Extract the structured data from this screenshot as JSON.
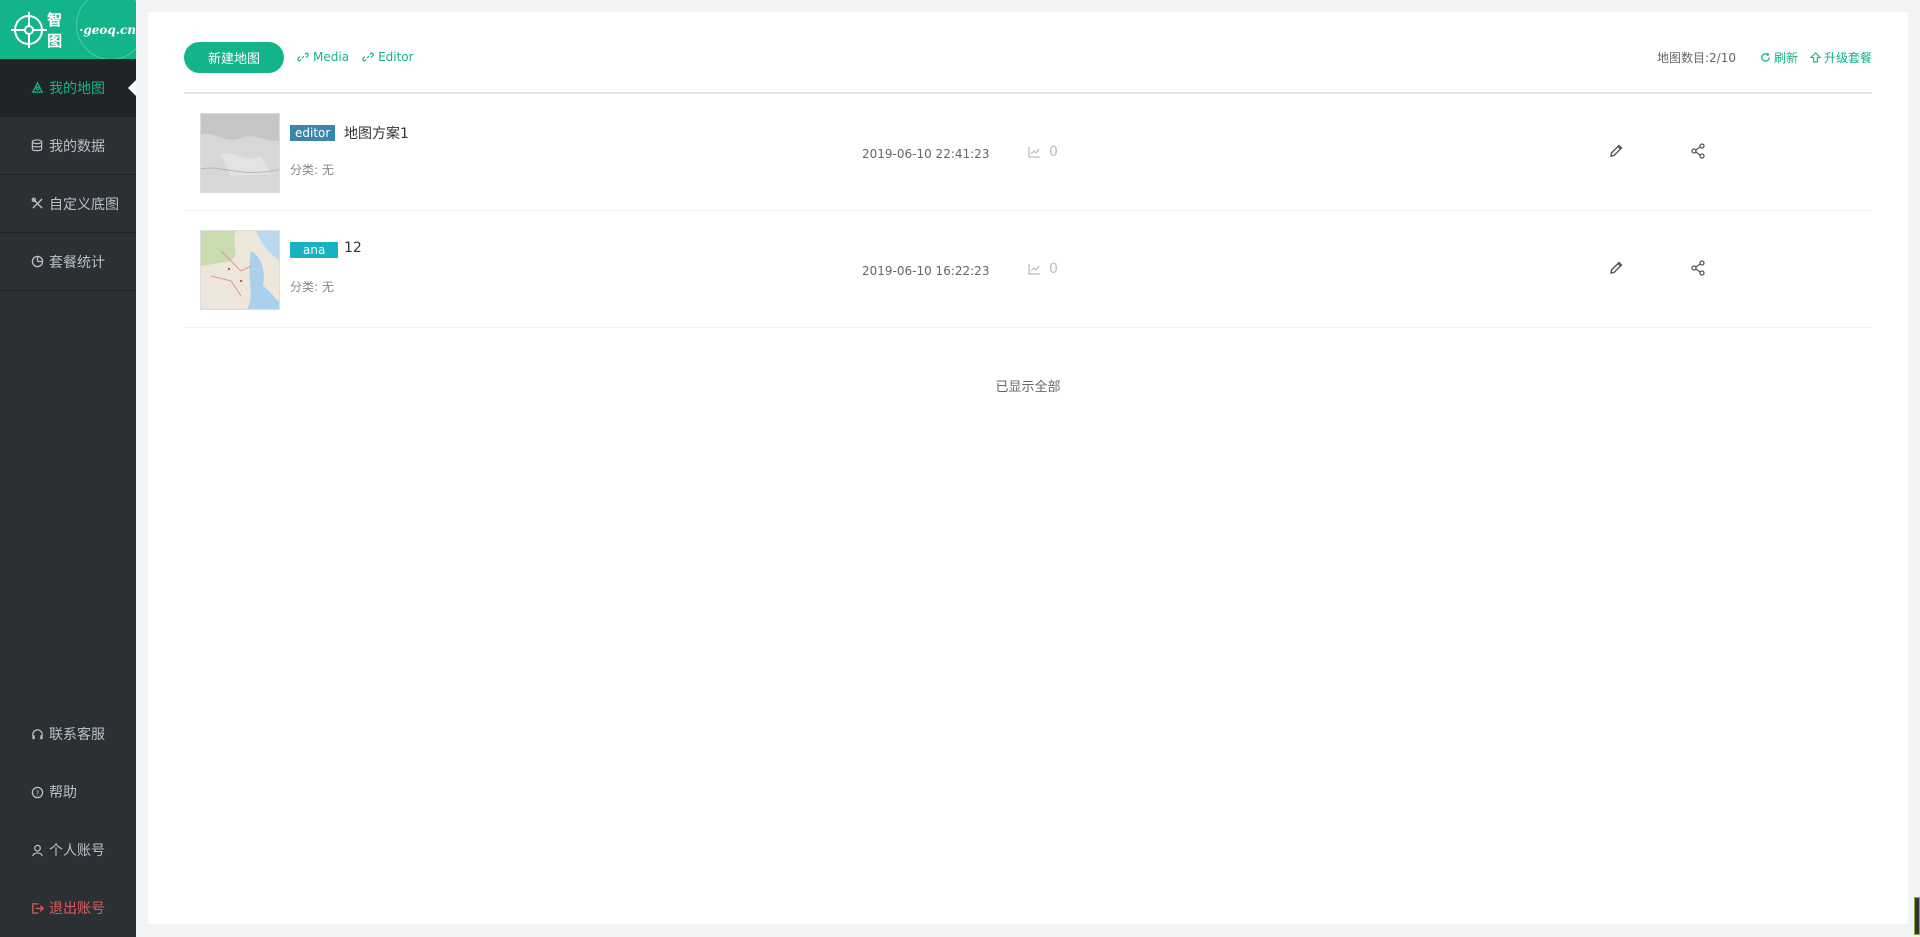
{
  "brand": {
    "name": "智图",
    "sub": "·geoq.cn"
  },
  "sidebar": {
    "items": [
      {
        "label": "我的地图",
        "icon": "map-icon",
        "active": true
      },
      {
        "label": "我的数据",
        "icon": "database-icon",
        "active": false
      },
      {
        "label": "自定义底图",
        "icon": "tools-icon",
        "active": false
      },
      {
        "label": "套餐统计",
        "icon": "pie-chart-icon",
        "active": false
      }
    ],
    "bottom": [
      {
        "label": "联系客服",
        "icon": "headset-icon"
      },
      {
        "label": "帮助",
        "icon": "help-icon"
      },
      {
        "label": "个人账号",
        "icon": "user-icon"
      },
      {
        "label": "退出账号",
        "icon": "logout-icon"
      }
    ]
  },
  "toolbar": {
    "new_map_label": "新建地图",
    "links": [
      "Media",
      "Editor"
    ],
    "map_count": "地图数目:2/10",
    "refresh_label": "刷新",
    "upgrade_label": "升级套餐"
  },
  "maps": [
    {
      "tag": "editor",
      "title": "地图方案1",
      "category": "分类: 无",
      "date": "2019-06-10 22:41:23",
      "views": "0"
    },
    {
      "tag": "ana",
      "title": "12",
      "category": "分类: 无",
      "date": "2019-06-10 16:22:23",
      "views": "0"
    }
  ],
  "footer_note": "已显示全部",
  "colors": {
    "accent": "#13b489",
    "sidebar": "#2b3034",
    "editor_tag": "#3a87ad",
    "ana_tag": "#17b3c0",
    "logout": "#e05a5a"
  }
}
